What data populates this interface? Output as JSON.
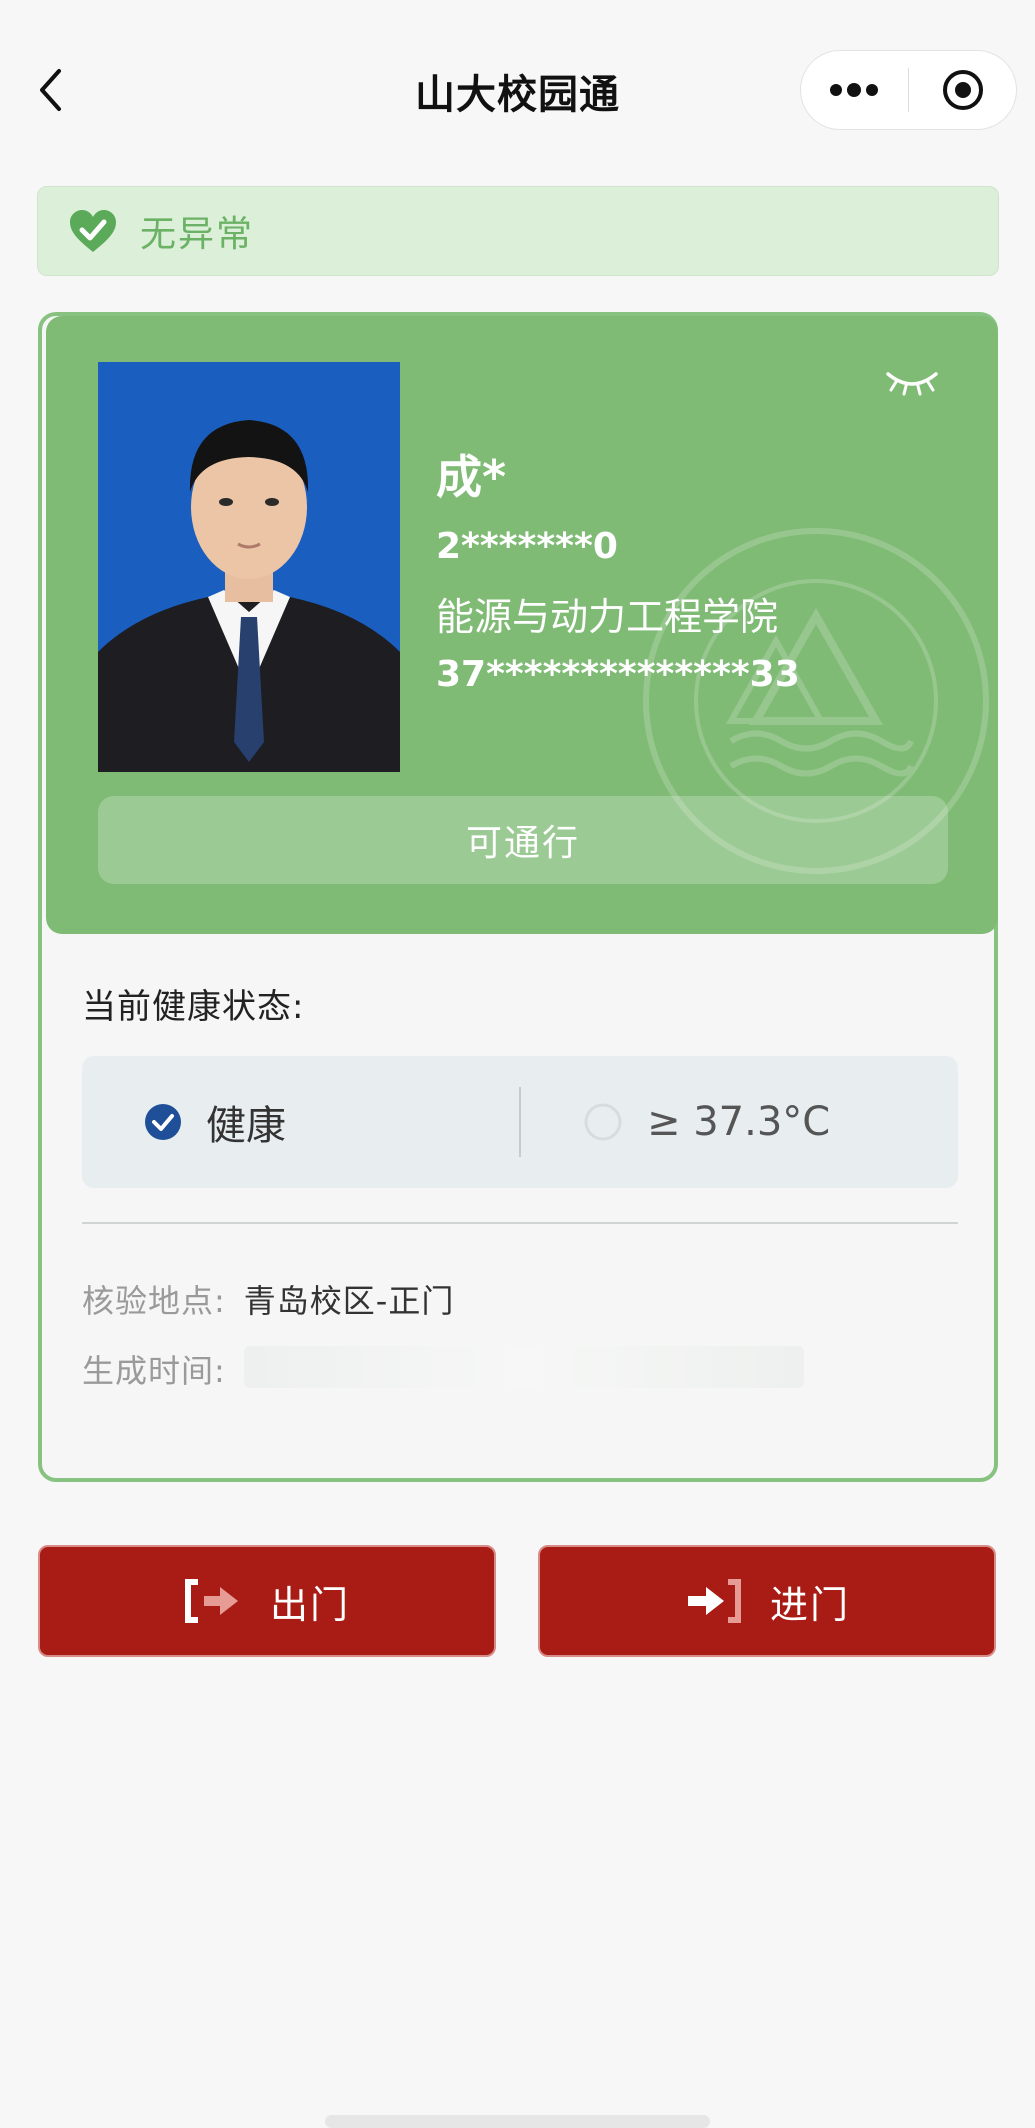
{
  "navbar": {
    "title": "山大校园通"
  },
  "status": {
    "text": "无异常",
    "color": "#6cb266"
  },
  "profile": {
    "name": "成*",
    "student_id": "2*******0",
    "department": "能源与动力工程学院",
    "id_card": "37**************33",
    "pass_label": "可通行",
    "card_color": "#80bb76"
  },
  "health": {
    "title": "当前健康状态:",
    "options": [
      {
        "label": "健康",
        "selected": true
      },
      {
        "label": "≥ 37.3°C",
        "selected": false
      }
    ]
  },
  "info": {
    "location_label": "核验地点:",
    "location_value": "青岛校区-正门",
    "time_label": "生成时间:"
  },
  "actions": {
    "exit_label": "出门",
    "enter_label": "进门",
    "button_color": "#a91c15"
  }
}
